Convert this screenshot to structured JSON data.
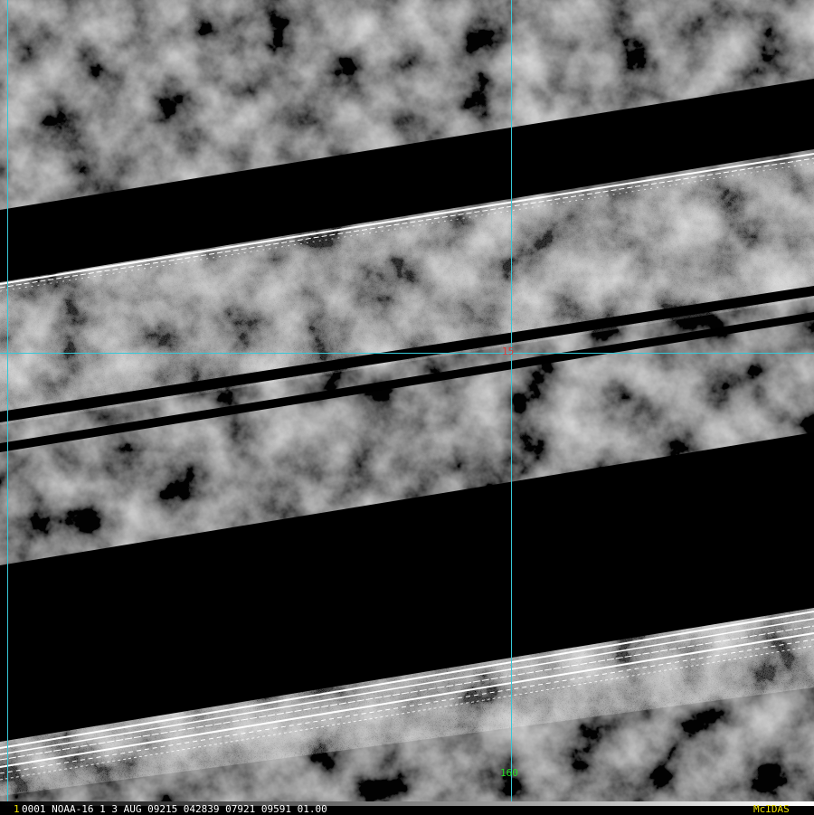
{
  "image": {
    "gridline_color": "#36c8d8",
    "latitude_label": "15",
    "latitude_label_color": "#e03a3a",
    "longitude_label": "160",
    "longitude_label_color": "#22dd22"
  },
  "status_bar": {
    "frame_number": "1",
    "frame_number_color": "#f0e000",
    "metadata": "0001 NOAA-16     1  3 AUG 09215 042839 07921 09591 01.00",
    "metadata_color": "#ffffff",
    "brand": "McIDAS",
    "brand_color": "#f0e000"
  }
}
